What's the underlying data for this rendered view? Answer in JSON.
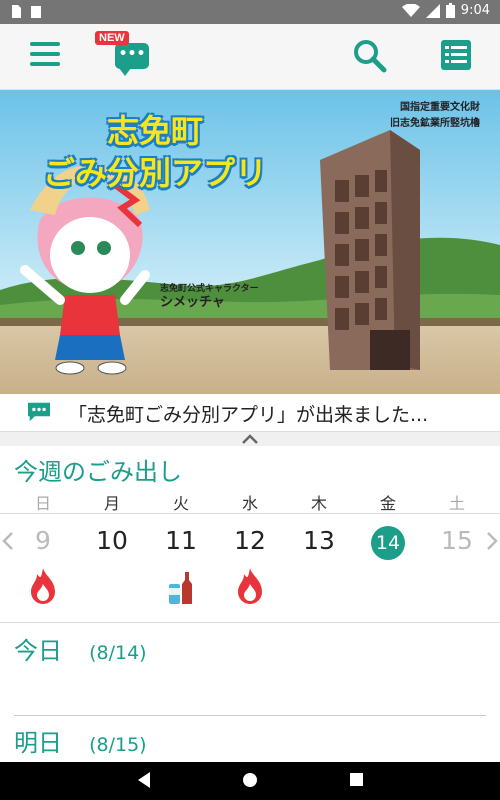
{
  "status_bar": {
    "time": "9:04",
    "icons": [
      "notification-a-icon",
      "notification-b-icon",
      "wifi-icon",
      "cell-signal-icon",
      "battery-icon"
    ]
  },
  "app_bar": {
    "new_badge": "NEW",
    "icons": [
      "hamburger-menu-icon",
      "chat-bubble-icon",
      "search-icon",
      "list-icon"
    ],
    "accent_color": "#1b9e8a"
  },
  "banner": {
    "title_line1": "志免町",
    "title_line2": "ごみ分別アプリ",
    "heritage_line1": "国指定重要文化財",
    "heritage_line2": "旧志免鉱業所竪坑櫓",
    "mascot_caption": "志免町公式キャラクター",
    "mascot_name": "シメッチャ"
  },
  "notice": {
    "text": "「志免町ごみ分別アプリ」が出来ました..."
  },
  "week": {
    "title": "今週のごみ出し",
    "days": [
      {
        "weekday": "日",
        "date": "9",
        "state": "dim",
        "garbage": "burnable"
      },
      {
        "weekday": "月",
        "date": "10",
        "state": "normal",
        "garbage": ""
      },
      {
        "weekday": "火",
        "date": "11",
        "state": "normal",
        "garbage": "cans-bottles"
      },
      {
        "weekday": "水",
        "date": "12",
        "state": "normal",
        "garbage": "burnable"
      },
      {
        "weekday": "木",
        "date": "13",
        "state": "normal",
        "garbage": ""
      },
      {
        "weekday": "金",
        "date": "14",
        "state": "today",
        "garbage": ""
      },
      {
        "weekday": "土",
        "date": "15",
        "state": "dim",
        "garbage": ""
      }
    ]
  },
  "detail": {
    "today_label": "今日",
    "today_date": "(8/14)",
    "tomorrow_label": "明日",
    "tomorrow_date": "(8/15)"
  },
  "colors": {
    "accent": "#1b9e8a",
    "burnable": "#e8343a",
    "title_yellow": "#f8e51a",
    "title_outline": "#1b7fc1"
  }
}
